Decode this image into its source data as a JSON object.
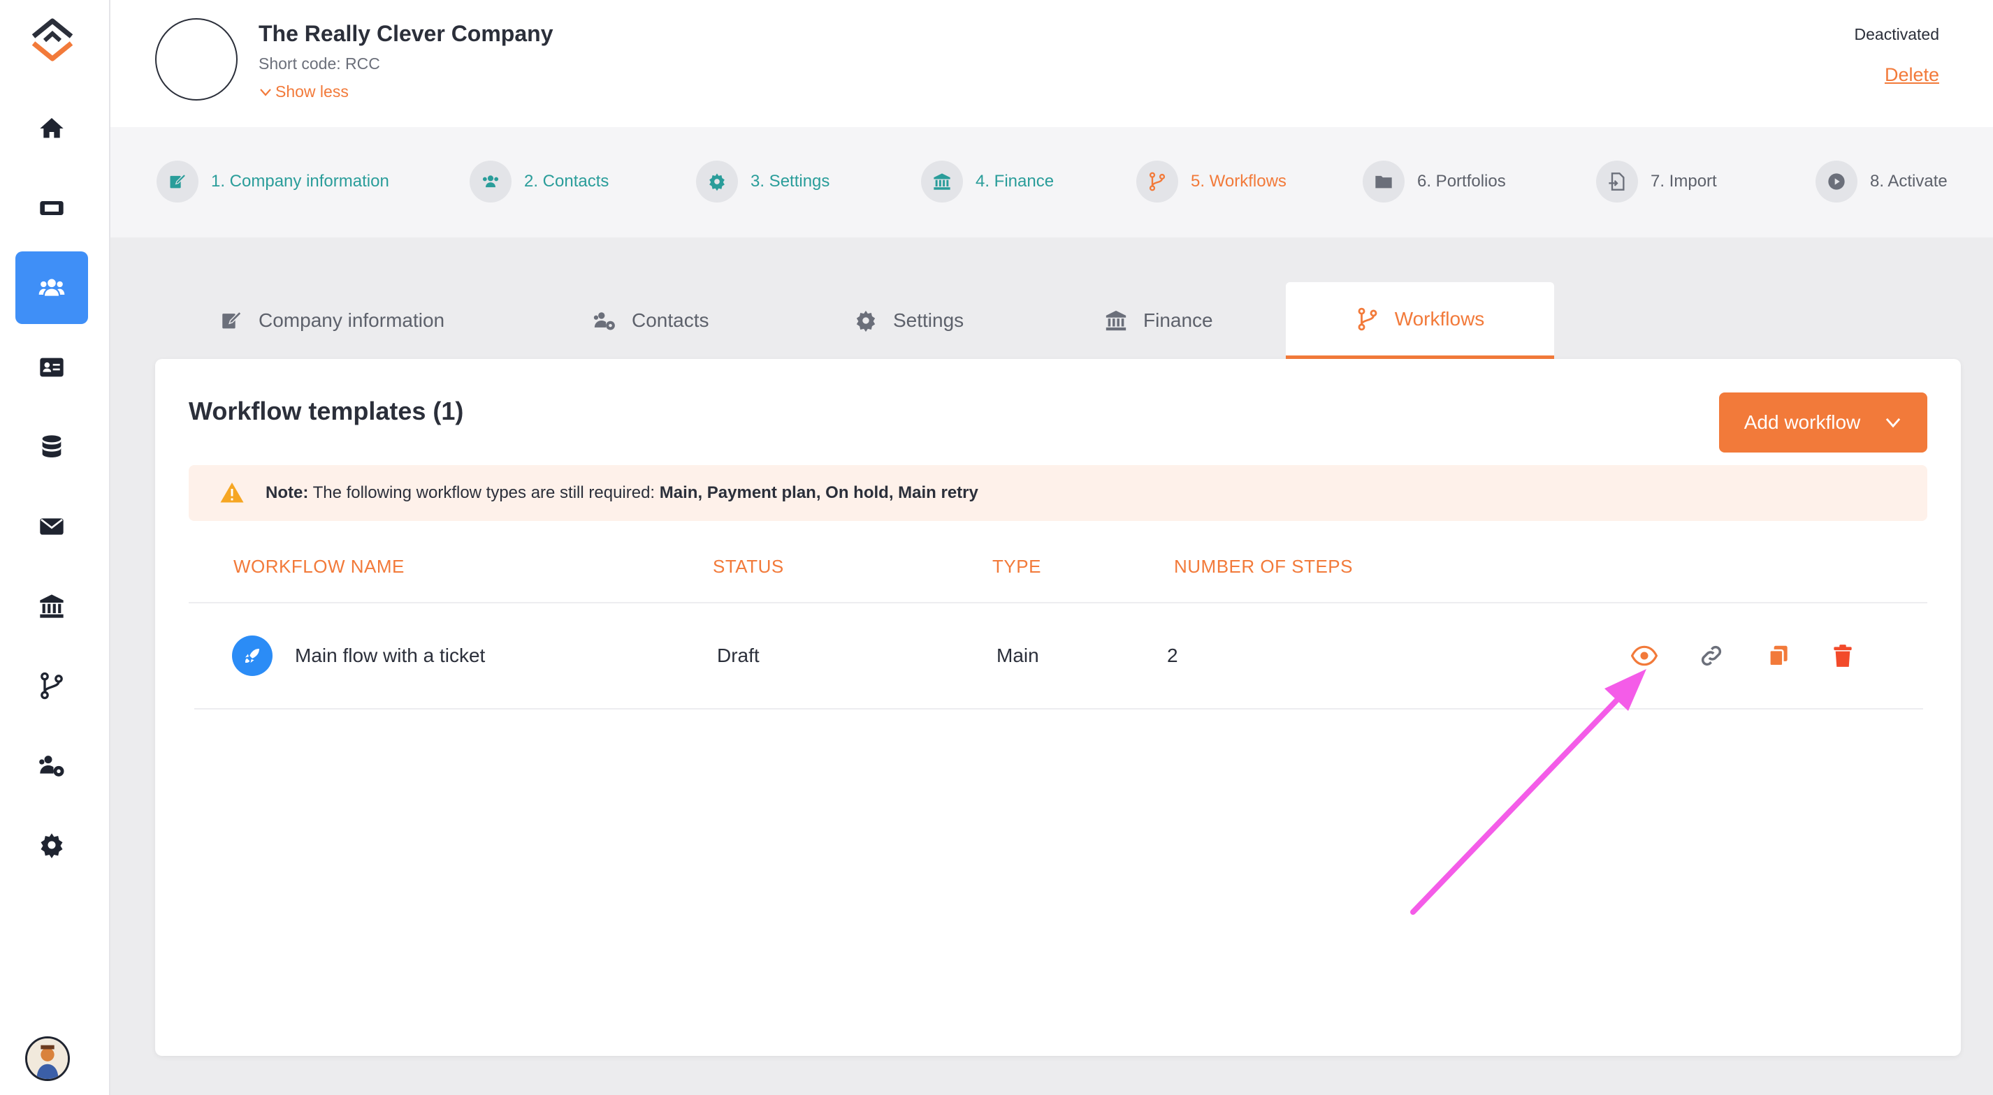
{
  "colors": {
    "accent": "#f27a3a",
    "teal": "#2a9d9a",
    "active_nav": "#3f8ff7",
    "annotation_arrow": "#f45ce8"
  },
  "sidebar": {
    "items": [
      {
        "icon": "home-icon"
      },
      {
        "icon": "ticket-icon"
      },
      {
        "icon": "users-icon",
        "active": true
      },
      {
        "icon": "id-card-icon"
      },
      {
        "icon": "database-icon"
      },
      {
        "icon": "envelope-icon"
      },
      {
        "icon": "bank-icon"
      },
      {
        "icon": "workflow-branch-icon"
      },
      {
        "icon": "users-cog-icon"
      },
      {
        "icon": "gear-icon"
      }
    ]
  },
  "header": {
    "company_name": "The Really Clever Company",
    "short_code": "Short code: RCC",
    "show_less": "Show less",
    "status": "Deactivated",
    "delete": "Delete"
  },
  "stepper": {
    "steps": [
      {
        "label": "1. Company information",
        "state": "done",
        "icon": "edit-icon"
      },
      {
        "label": "2. Contacts",
        "state": "done",
        "icon": "users-icon"
      },
      {
        "label": "3. Settings",
        "state": "done",
        "icon": "gear-icon"
      },
      {
        "label": "4. Finance",
        "state": "done",
        "icon": "bank-icon"
      },
      {
        "label": "5. Workflows",
        "state": "current",
        "icon": "workflow-branch-icon"
      },
      {
        "label": "6. Portfolios",
        "state": "todo",
        "icon": "folder-icon"
      },
      {
        "label": "7. Import",
        "state": "todo",
        "icon": "import-icon"
      },
      {
        "label": "8. Activate",
        "state": "todo",
        "icon": "play-icon"
      }
    ]
  },
  "tabs": [
    {
      "label": "Company information",
      "icon": "edit-icon"
    },
    {
      "label": "Contacts",
      "icon": "users-icon"
    },
    {
      "label": "Settings",
      "icon": "gear-icon"
    },
    {
      "label": "Finance",
      "icon": "bank-icon"
    },
    {
      "label": "Workflows",
      "icon": "workflow-branch-icon",
      "active": true
    }
  ],
  "card": {
    "title": "Workflow templates (1)",
    "add_button": "Add workflow",
    "note": {
      "prefix": "Note:",
      "text": " The following workflow types are still required: ",
      "required": "Main, Payment plan, On hold, Main retry"
    },
    "columns": [
      "WORKFLOW NAME",
      "STATUS",
      "TYPE",
      "NUMBER OF STEPS"
    ],
    "rows": [
      {
        "name": "Main flow with a ticket",
        "status": "Draft",
        "type": "Main",
        "steps": "2"
      }
    ],
    "row_actions": [
      "eye-icon",
      "link-icon",
      "copy-icon",
      "trash-icon"
    ]
  }
}
